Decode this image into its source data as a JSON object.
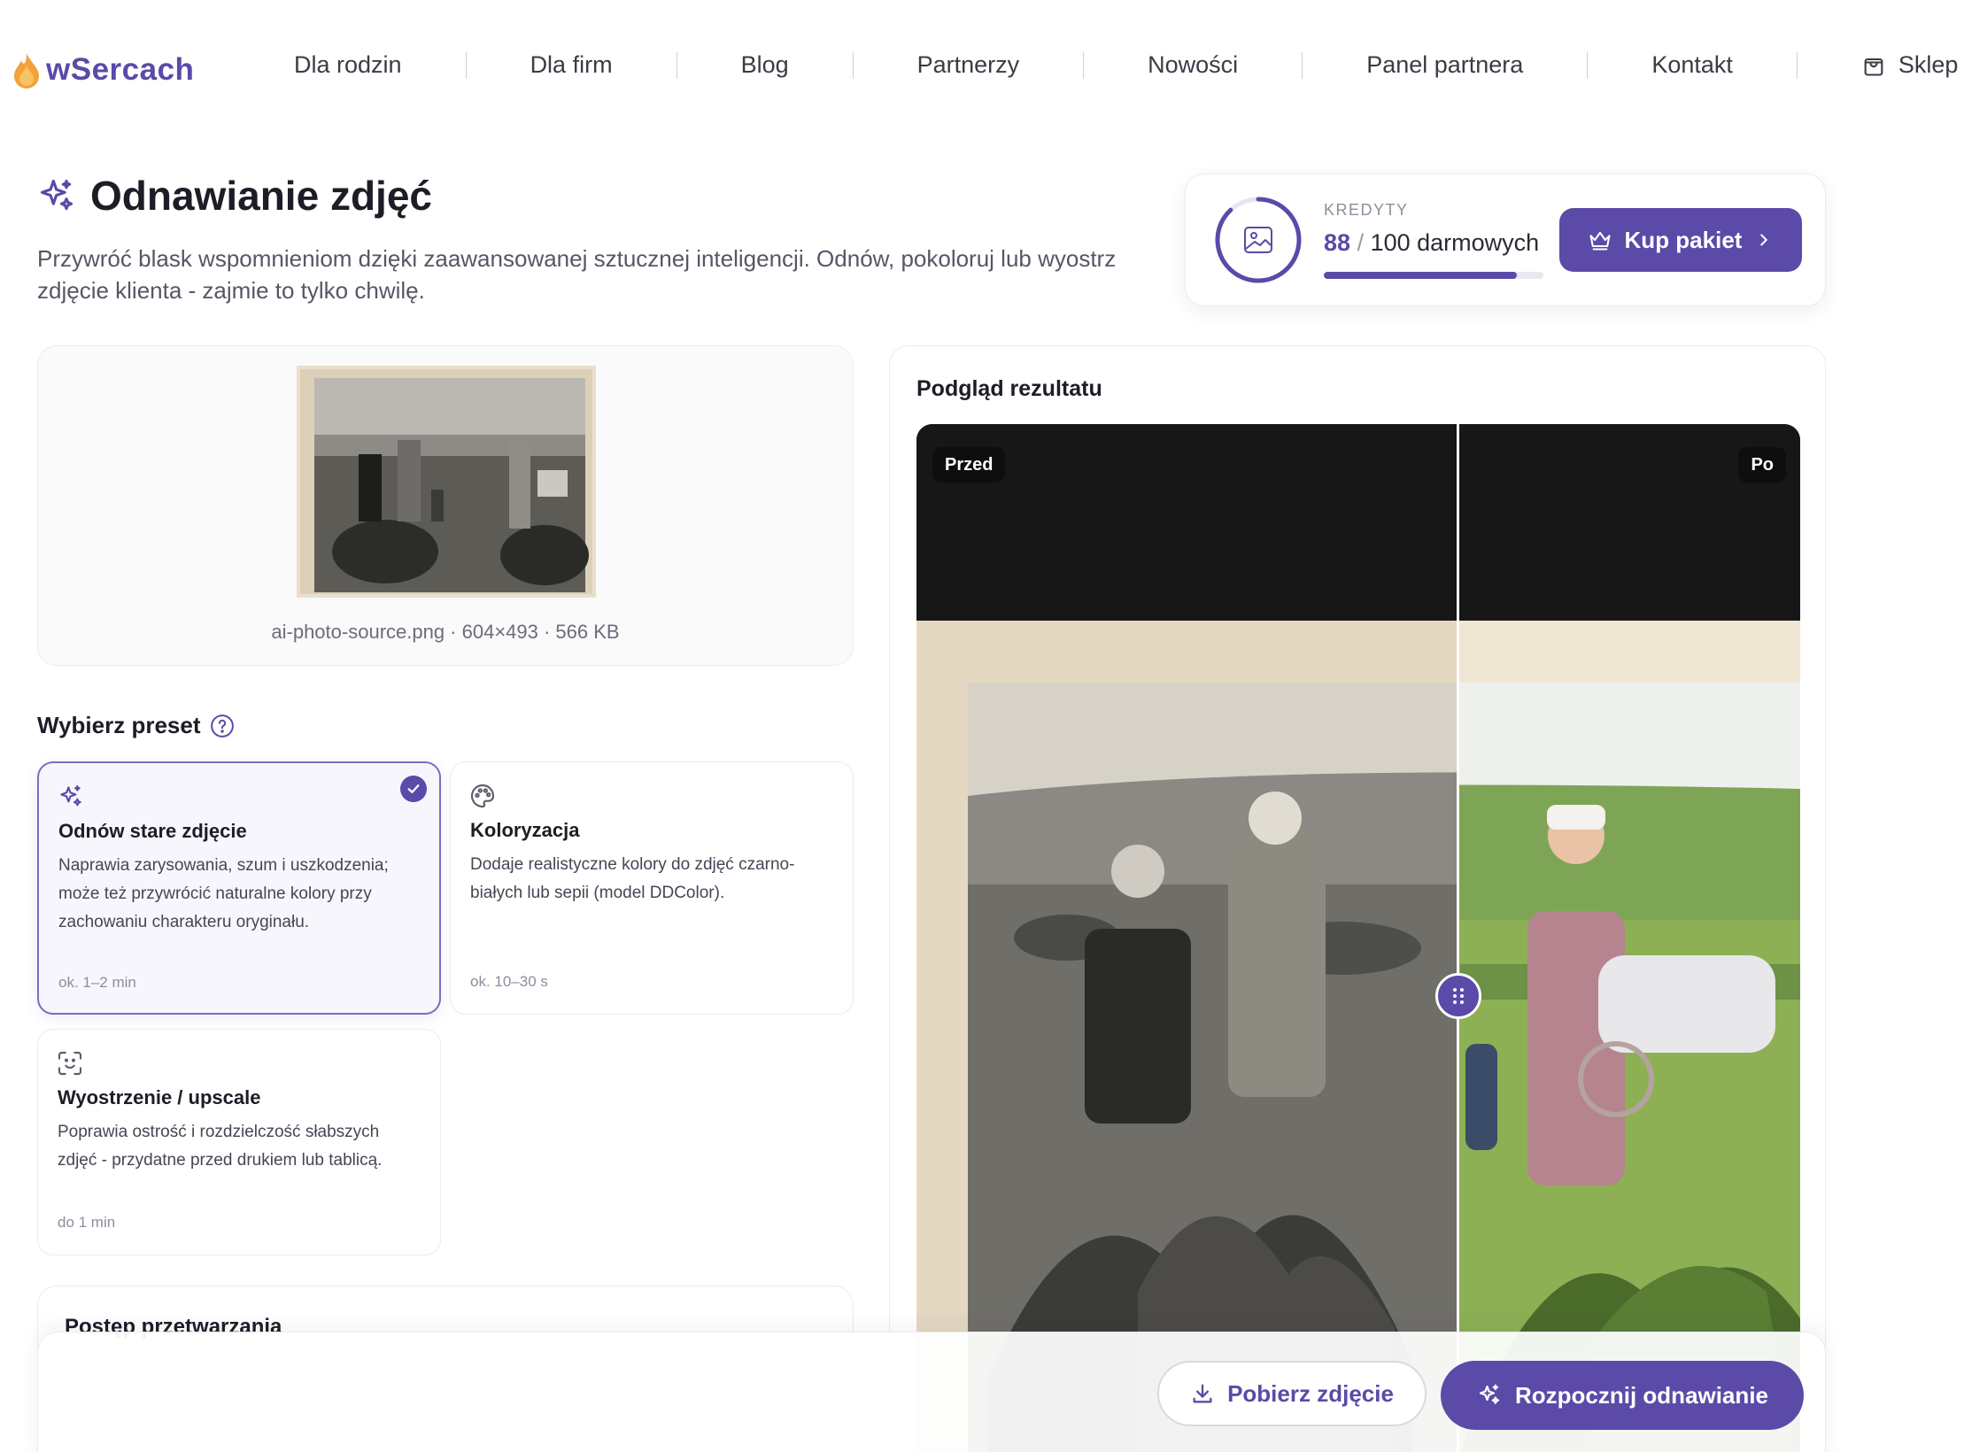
{
  "brand": {
    "name": "wSercach"
  },
  "nav": {
    "items": [
      "Dla rodzin",
      "Dla firm",
      "Blog",
      "Partnerzy",
      "Nowości",
      "Panel partnera",
      "Kontakt"
    ],
    "shop_label": "Sklep"
  },
  "hero": {
    "title": "Odnawianie zdjęć",
    "subtitle": "Przywróć blask wspomnieniom dzięki zaawansowanej sztucznej inteligencji. Odnów, pokoloruj lub wyostrz zdjęcie klienta - zajmie to tylko chwilę."
  },
  "credits": {
    "label": "KREDYTY",
    "used": "88",
    "separator": "/",
    "total_text": "100 darmowych",
    "fraction": 0.88,
    "buy_label": "Kup pakiet"
  },
  "upload": {
    "file_meta": "ai-photo-source.png · 604×493 · 566 KB"
  },
  "presets": {
    "heading": "Wybierz preset",
    "items": [
      {
        "title": "Odnów stare zdjęcie",
        "desc": "Naprawia zarysowania, szum i uszkodzenia; może też przywrócić naturalne kolory przy zachowaniu charakteru oryginału.",
        "time": "ok. 1–2 min",
        "selected": true
      },
      {
        "title": "Koloryzacja",
        "desc": "Dodaje realistyczne kolory do zdjęć czarno-białych lub sepii (model DDColor).",
        "time": "ok. 10–30 s",
        "selected": false
      },
      {
        "title": "Wyostrzenie / upscale",
        "desc": "Poprawia ostrość i rozdzielczość słabszych zdjęć - przydatne przed drukiem lub tablicą.",
        "time": "do 1 min",
        "selected": false
      }
    ]
  },
  "progress": {
    "title": "Postęp przetwarzania"
  },
  "preview": {
    "title": "Podgląd rezultatu",
    "before_label": "Przed",
    "after_label": "Po"
  },
  "actions": {
    "download_label": "Pobierz zdjęcie",
    "start_label": "Rozpocznij odnawianie"
  },
  "colors": {
    "accent": "#5b4aa8",
    "accent_light": "#f7f6fc",
    "text": "#1c1d26",
    "muted": "#8c8e9c"
  },
  "icons": {
    "logo": "flame-drop-icon",
    "shop": "shopping-bag-icon",
    "title": "sparkles-icon",
    "credit": "image-icon",
    "buy": "crown-icon",
    "help": "question-circle-icon",
    "preset_restore": "sparkles-icon",
    "preset_colorize": "palette-icon",
    "preset_upscale": "scan-face-icon",
    "download": "download-icon",
    "start": "sparkles-icon"
  }
}
